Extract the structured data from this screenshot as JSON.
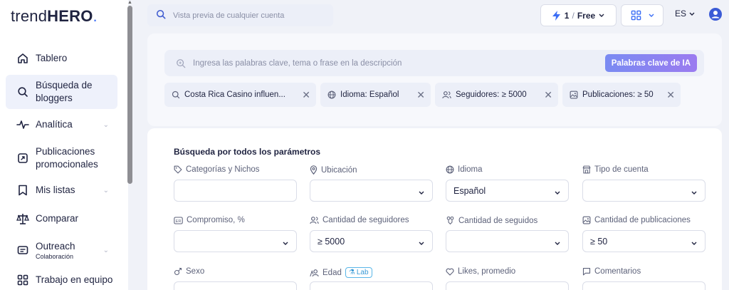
{
  "brand": {
    "name_light": "trend",
    "name_bold": "HERO",
    "dot": "."
  },
  "sidebar": {
    "items": [
      {
        "label": "Tablero",
        "icon": "home-icon"
      },
      {
        "label": "Búsqueda de bloggers",
        "icon": "search-icon",
        "active": true
      },
      {
        "label": "Analítica",
        "icon": "analytics-icon",
        "has_chevron": true
      },
      {
        "label": "Publicaciones promocionales",
        "icon": "promo-posts-icon"
      },
      {
        "label": "Mis listas",
        "icon": "bookmark-icon",
        "has_chevron": true
      },
      {
        "label": "Comparar",
        "icon": "scales-icon"
      },
      {
        "label": "Outreach",
        "sublabel": "Colaboración",
        "icon": "outreach-icon",
        "has_chevron": true
      },
      {
        "label": "Trabajo en equipo",
        "icon": "team-grid-icon"
      }
    ]
  },
  "topbar": {
    "search_placeholder": "Vista previa de cualquier cuenta",
    "plan_count": "1",
    "plan_sep": "/",
    "plan_name": "Free",
    "language": "ES"
  },
  "keywords": {
    "placeholder": "Ingresa las palabras clave, tema o frase en la descripción",
    "ai_button": "Palabras clave de IA",
    "chips": [
      {
        "label": "Costa Rica Casino influen...",
        "icon": "keyword-search-icon"
      },
      {
        "label": "Idioma: Español",
        "icon": "globe-icon"
      },
      {
        "label": "Seguidores: ≥ 5000",
        "icon": "followers-icon"
      },
      {
        "label": "Publicaciones: ≥ 50",
        "icon": "image-icon"
      }
    ]
  },
  "filters": {
    "title": "Búsqueda por todos los parámetros",
    "fields": [
      {
        "label": "Categorías y Nichos",
        "icon": "tag-icon",
        "value": "",
        "dropdown": false
      },
      {
        "label": "Ubicación",
        "icon": "location-icon",
        "value": "",
        "dropdown": true
      },
      {
        "label": "Idioma",
        "icon": "globe-icon",
        "value": "Español",
        "dropdown": true
      },
      {
        "label": "Tipo de cuenta",
        "icon": "store-icon",
        "value": "",
        "dropdown": true
      },
      {
        "label": "Compromiso, %",
        "icon": "er-icon",
        "value": "",
        "dropdown": true
      },
      {
        "label": "Cantidad de seguidores",
        "icon": "followers-icon",
        "value": "≥ 5000",
        "dropdown": true
      },
      {
        "label": "Cantidad de seguidos",
        "icon": "following-icon",
        "value": "",
        "dropdown": true
      },
      {
        "label": "Cantidad de publicaciones",
        "icon": "image-icon",
        "value": "≥ 50",
        "dropdown": true
      },
      {
        "label": "Sexo",
        "icon": "gender-icon",
        "value": "",
        "dropdown": false
      },
      {
        "label": "Edad",
        "icon": "age-icon",
        "value": "",
        "dropdown": false,
        "badge": "Lab"
      },
      {
        "label": "Likes, promedio",
        "icon": "heart-icon",
        "value": "",
        "dropdown": false
      },
      {
        "label": "Comentarios",
        "icon": "comment-icon",
        "value": "",
        "dropdown": false
      }
    ]
  },
  "colors": {
    "accent": "#3b6ef5",
    "ai_gradient_start": "#7a8bf2",
    "ai_gradient_end": "#9b7bf0",
    "background": "#f0f2f8"
  }
}
